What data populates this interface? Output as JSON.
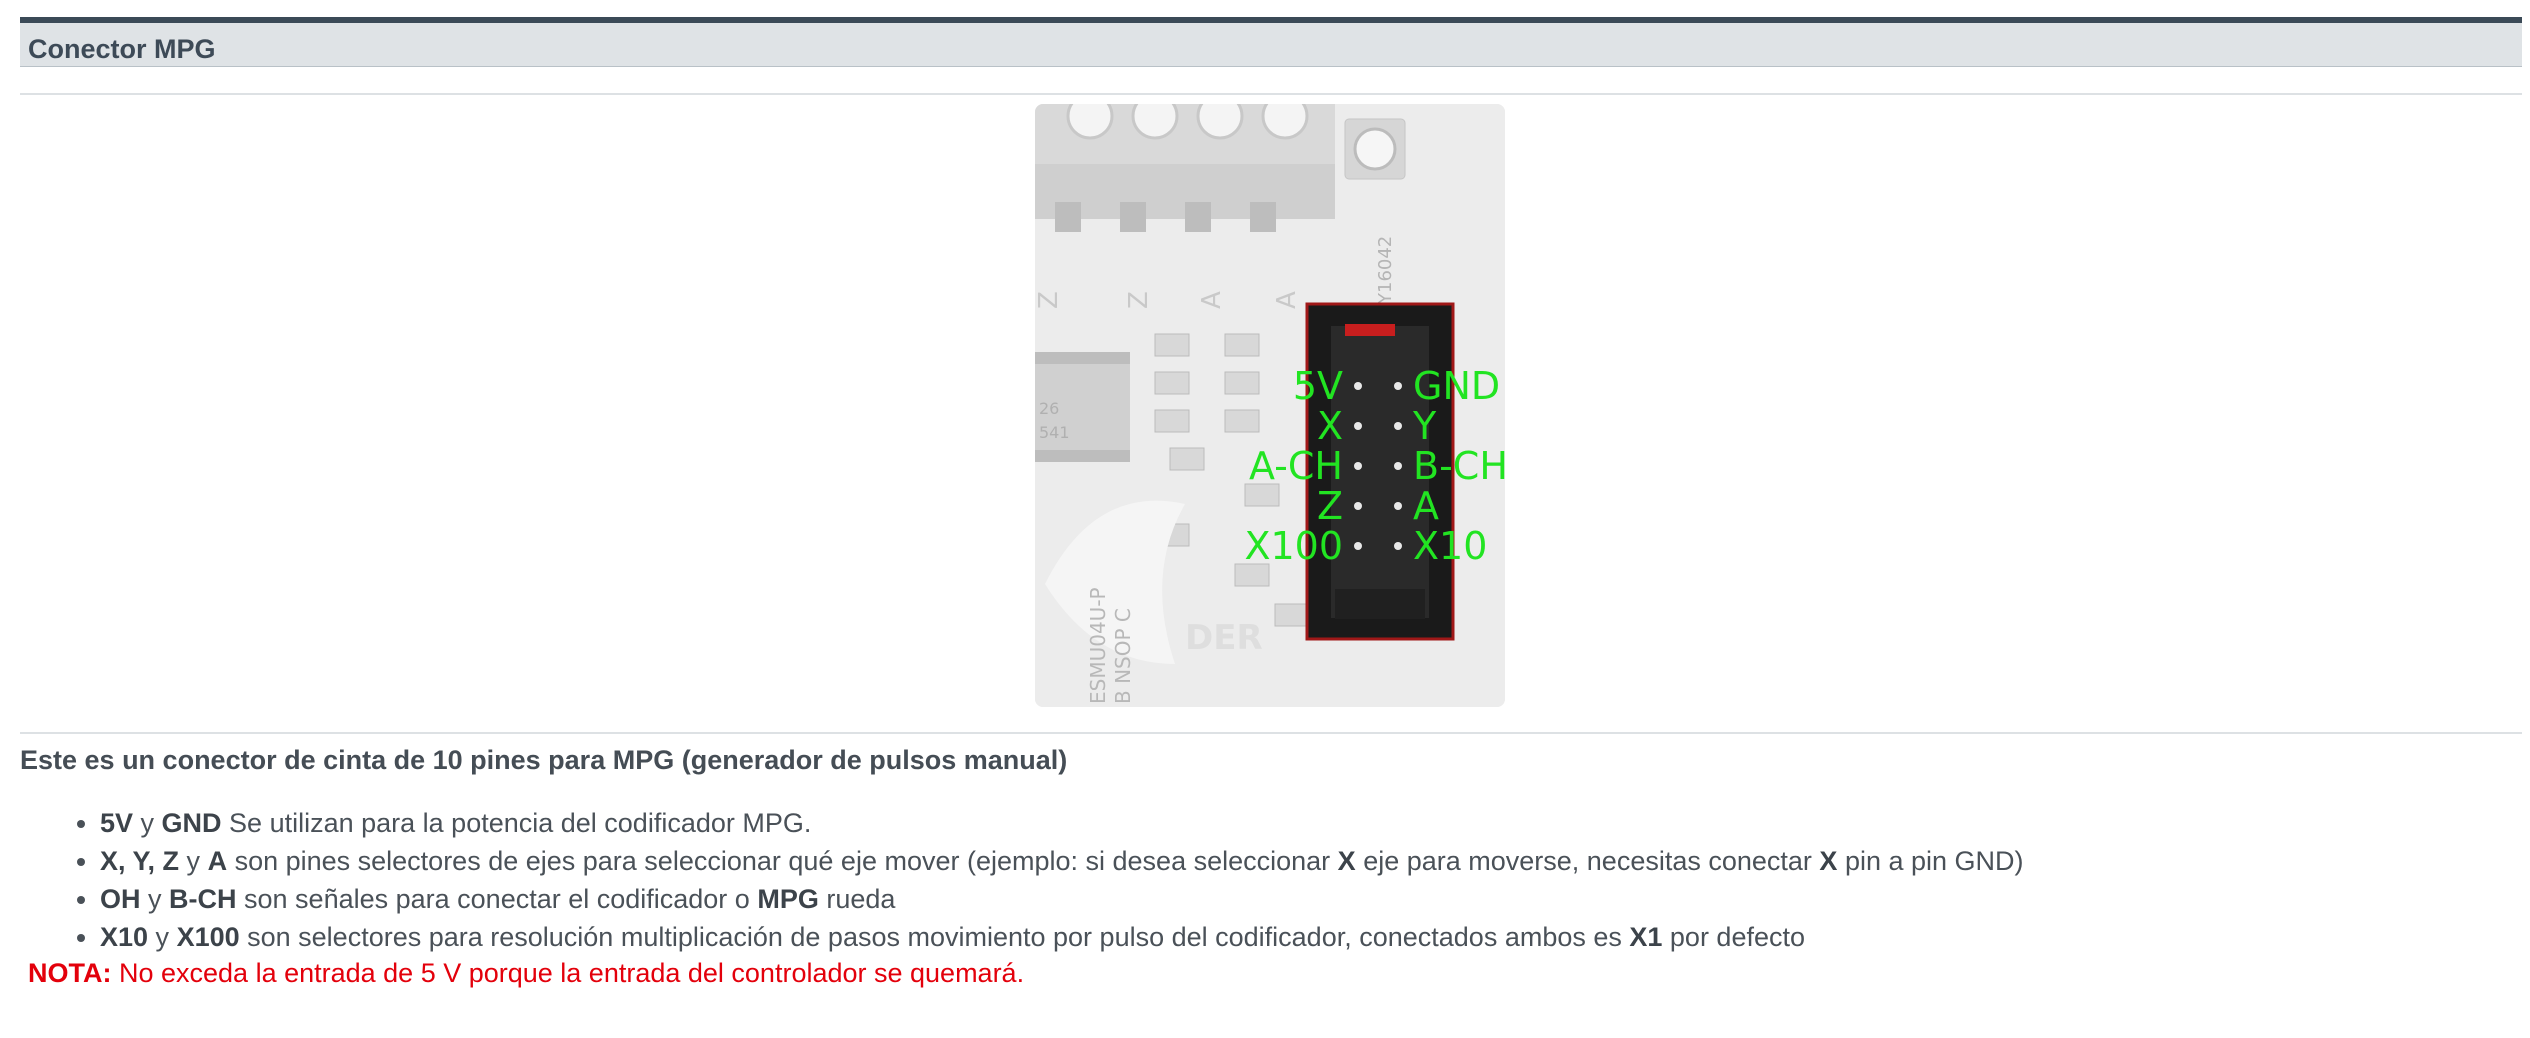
{
  "section": {
    "title": "Conector MPG"
  },
  "figure": {
    "pin_labels_left": [
      "5V",
      "X",
      "A-CH",
      "Z",
      "X100"
    ],
    "pin_labels_right": [
      "GND",
      "Y",
      "B-CH",
      "A",
      "X10"
    ],
    "board_silkscreen": [
      "Z",
      "Z",
      "A",
      "A",
      "Y16042",
      "26",
      "541",
      "ESMU04U-P",
      "B NSOP C",
      "DER"
    ],
    "label_color": "#22e422"
  },
  "intro": "Este es un conector de cinta de 10 pines para MPG (generador de pulsos manual)",
  "bullets": [
    {
      "b1": "5V",
      "t1": " y ",
      "b2": "GND",
      "t2": " Se utilizan para la potencia del codificador MPG."
    },
    {
      "b1": "X, Y, Z",
      "t1": " y ",
      "b2": "A",
      "t2": " son pines selectores de ejes para seleccionar qué eje mover (ejemplo: si desea seleccionar ",
      "b3": "X",
      "t3": " eje para moverse, necesitas conectar ",
      "b4": "X",
      "t4": " pin a pin GND)"
    },
    {
      "b1": "OH",
      "t1": " y ",
      "b2": "B-CH",
      "t2": " son señales para conectar el codificador o ",
      "b3": "MPG",
      "t3": " rueda"
    },
    {
      "b1": "X10",
      "t1": " y ",
      "b2": "X100",
      "t2": " son selectores para resolución multiplicación de pasos movimiento por pulso del codificador, conectados ambos es ",
      "b3": "X1",
      "t3": " por defecto"
    }
  ],
  "note": {
    "label": "NOTA:",
    "text": " No exceda la entrada de 5 V porque la entrada del controlador se quemará.",
    "color": "#e3000b"
  }
}
